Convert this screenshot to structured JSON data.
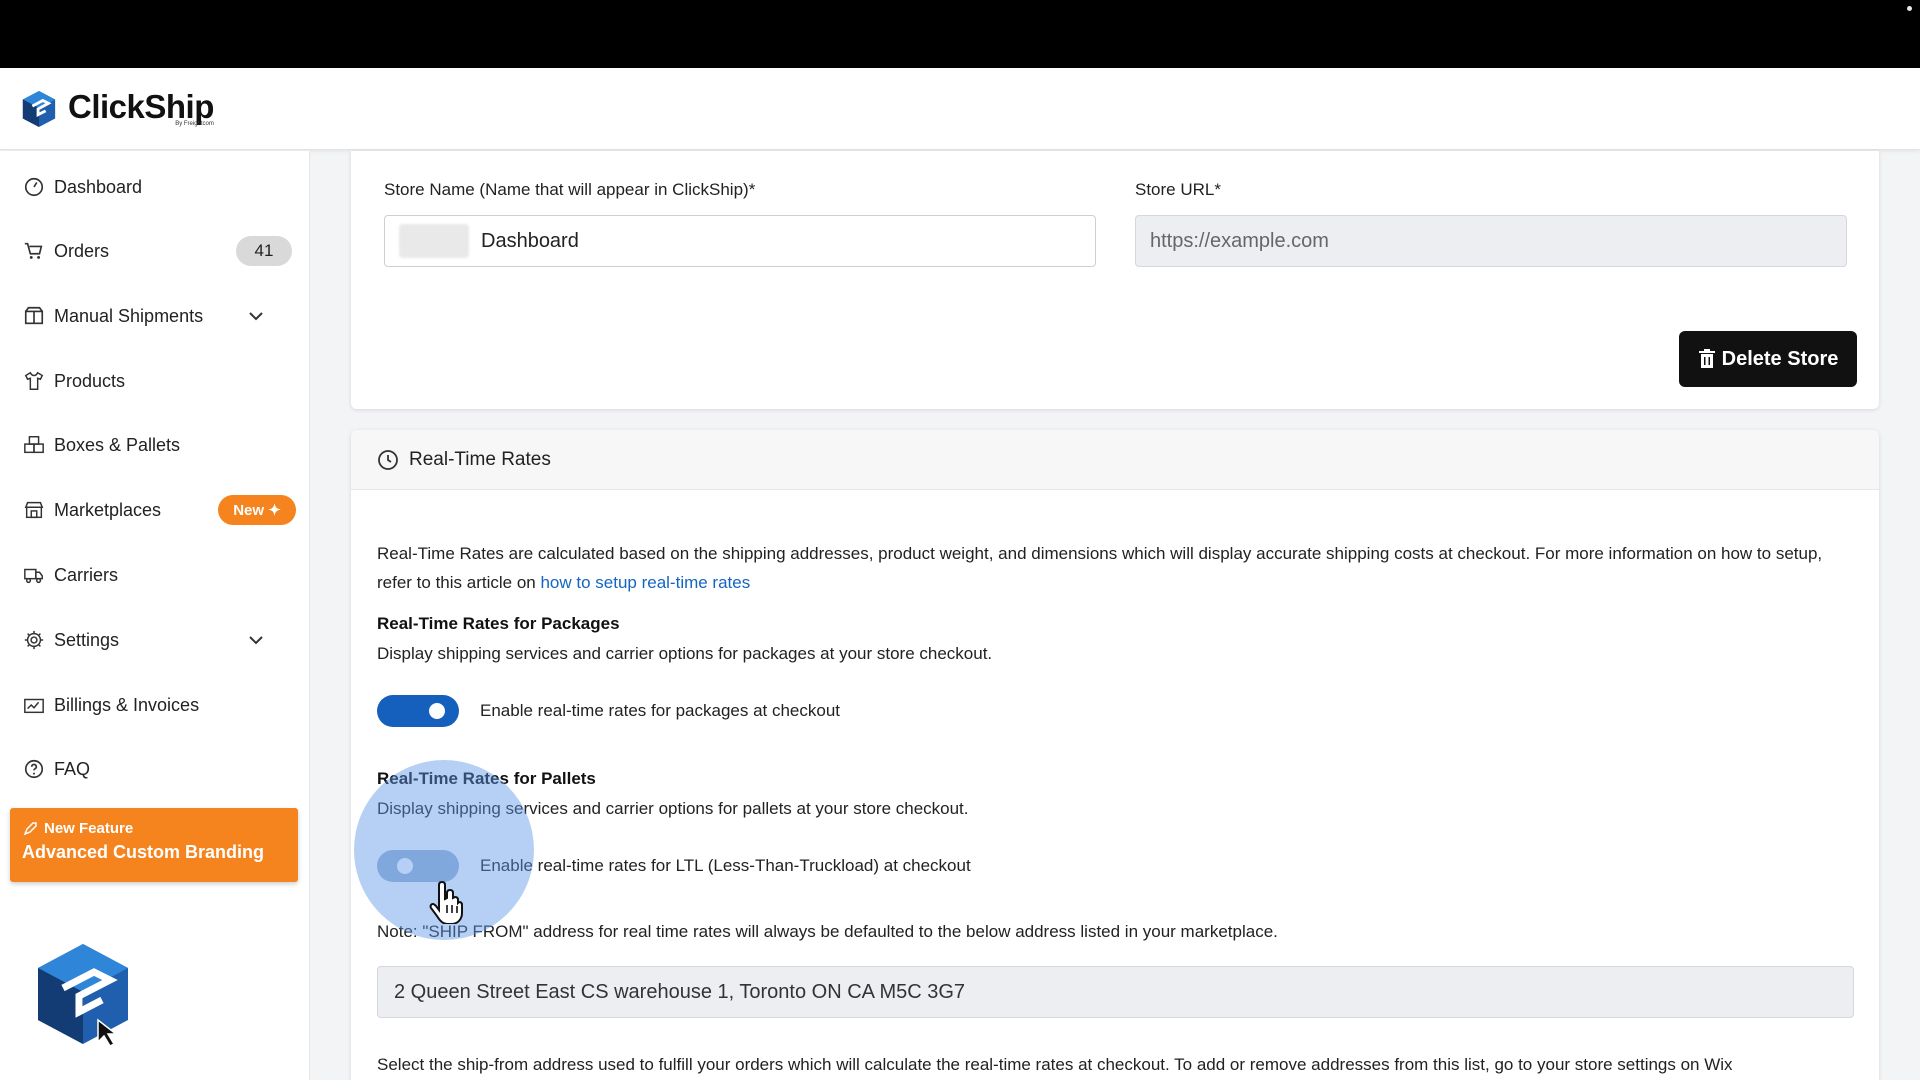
{
  "app": {
    "name": "ClickShip",
    "byline": "By Freightcom"
  },
  "sidebar": {
    "items": [
      {
        "label": "Dashboard",
        "icon": "gauge-icon"
      },
      {
        "label": "Orders",
        "icon": "cart-icon",
        "count": "41"
      },
      {
        "label": "Manual Shipments",
        "icon": "package-icon",
        "expandable": true
      },
      {
        "label": "Products",
        "icon": "shirt-icon"
      },
      {
        "label": "Boxes & Pallets",
        "icon": "boxes-icon"
      },
      {
        "label": "Marketplaces",
        "icon": "store-icon",
        "badge": "New ✦"
      },
      {
        "label": "Carriers",
        "icon": "truck-icon"
      },
      {
        "label": "Settings",
        "icon": "gear-icon",
        "expandable": true
      },
      {
        "label": "Billings & Invoices",
        "icon": "invoice-icon"
      },
      {
        "label": "FAQ",
        "icon": "question-icon"
      }
    ],
    "feature": {
      "tag": "New Feature",
      "title": "Advanced Custom Branding"
    }
  },
  "store": {
    "name_label": "Store Name (Name that will appear in ClickShip)*",
    "name_value": "Dashboard",
    "url_label": "Store URL*",
    "url_value": "https://example.com",
    "delete_label": "Delete Store"
  },
  "realtime": {
    "title": "Real-Time Rates",
    "intro": "Real-Time Rates are calculated based on the shipping addresses, product weight, and dimensions which will display accurate shipping costs at checkout. For more information on how to setup, refer to this article on ",
    "intro_link": "how to setup real-time rates",
    "packages_heading": "Real-Time Rates for Packages",
    "packages_desc": "Display shipping services and carrier options for packages at your store checkout.",
    "packages_toggle_label": "Enable real-time rates for packages at checkout",
    "packages_enabled": true,
    "pallets_heading": "Real-Time Rates for Pallets",
    "pallets_desc": "Display shipping services and carrier options for pallets at your store checkout.",
    "pallets_toggle_label": "Enable real-time rates for LTL (Less-Than-Truckload) at checkout",
    "pallets_enabled": false,
    "note": "Note: \"SHIP FROM\" address for real time rates will always be defaulted to the below address listed in your marketplace.",
    "address": "2 Queen Street East CS warehouse 1, Toronto ON CA M5C 3G7",
    "footer_text": "Select the ship-from address used to fulfill your orders which will calculate the real-time rates at checkout. To add or remove addresses from this list, go to your store settings on Wix"
  },
  "colors": {
    "accent": "#1560bd",
    "brand_orange": "#f5841f",
    "link": "#1565c0"
  }
}
